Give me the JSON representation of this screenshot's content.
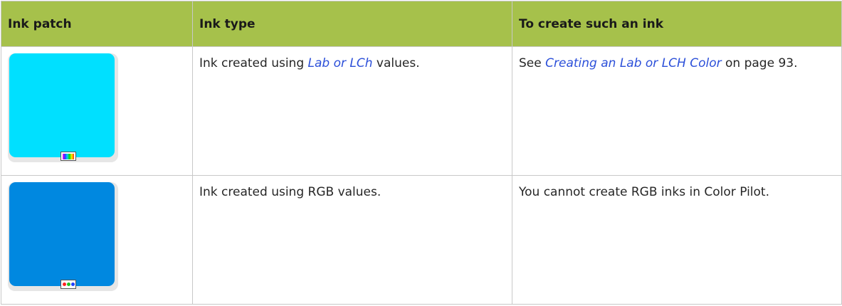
{
  "table": {
    "headers": [
      "Ink patch",
      "Ink type",
      "To create such an ink"
    ],
    "rows": [
      {
        "patch_color": "#00e0ff",
        "patch_icon": "lab-spectrum-icon",
        "type_before": "Ink created using ",
        "type_link": "Lab or LCh",
        "type_after": " values.",
        "create_before": "See ",
        "create_link": "Creating an Lab or LCH Color",
        "create_after": " on page 93."
      },
      {
        "patch_color": "#0088e0",
        "patch_icon": "rgb-dots-icon",
        "type_text": "Ink created using RGB values.",
        "create_text": "You cannot create RGB inks in Color Pilot."
      }
    ]
  },
  "colors": {
    "header_bg": "#a6c14b",
    "link": "#2b4fd9",
    "border": "#c8c8c8",
    "rgb_dot_red": "#ff2020",
    "rgb_dot_green": "#20c020",
    "rgb_dot_blue": "#2040ff"
  }
}
